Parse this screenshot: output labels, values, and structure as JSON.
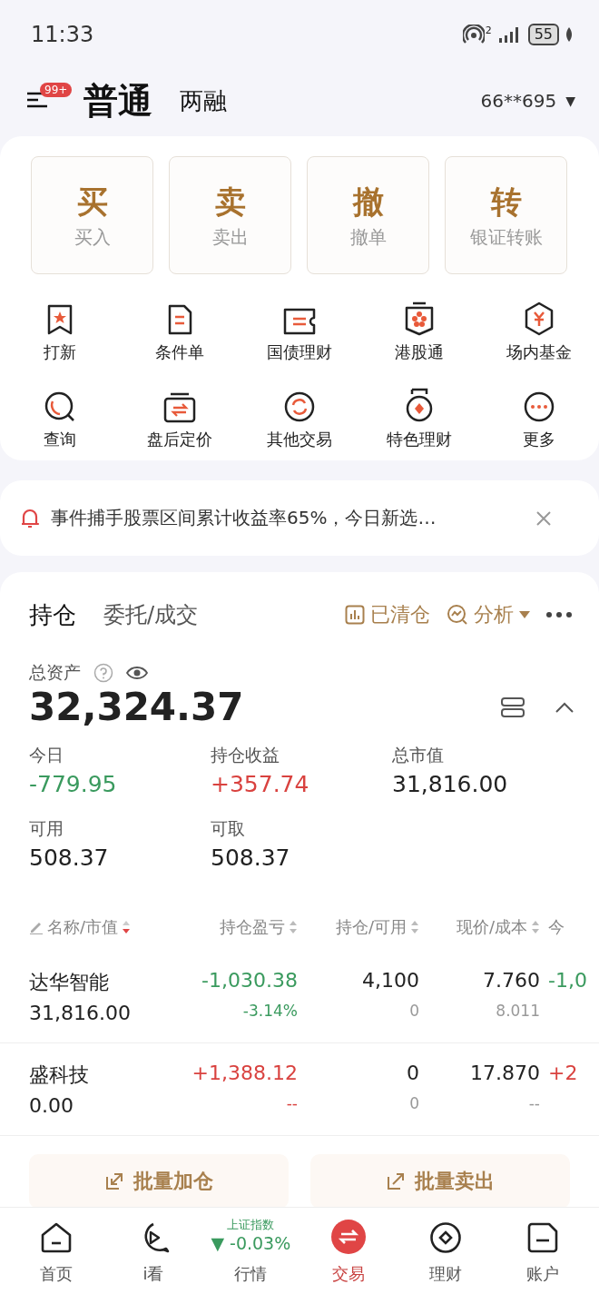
{
  "status_bar": {
    "time": "11:33",
    "hotspot_count": "2",
    "battery": "55"
  },
  "header": {
    "menu_badge": "99+",
    "tabs": [
      {
        "label": "普通",
        "selected": true
      },
      {
        "label": "两融",
        "selected": false
      }
    ],
    "account": "66**695",
    "account_caret": "▼"
  },
  "quick_actions": [
    {
      "glyph": "买",
      "label": "买入"
    },
    {
      "glyph": "卖",
      "label": "卖出"
    },
    {
      "glyph": "撤",
      "label": "撤单"
    },
    {
      "glyph": "转",
      "label": "银证转账"
    }
  ],
  "shortcuts": [
    {
      "label": "打新"
    },
    {
      "label": "条件单"
    },
    {
      "label": "国债理财"
    },
    {
      "label": "港股通"
    },
    {
      "label": "场内基金"
    },
    {
      "label": "查询"
    },
    {
      "label": "盘后定价"
    },
    {
      "label": "其他交易"
    },
    {
      "label": "特色理财"
    },
    {
      "label": "更多"
    }
  ],
  "notice": {
    "text": "事件捕手股票区间累计收益率65%，今日新选…"
  },
  "positions": {
    "tabs": [
      {
        "label": "持仓",
        "selected": true
      },
      {
        "label": "委托/成交",
        "selected": false
      }
    ],
    "actions": [
      {
        "label": "已清仓",
        "dropdown": false
      },
      {
        "label": "分析",
        "dropdown": true
      }
    ],
    "total_label": "总资产",
    "total": "32,324.37",
    "expanded": true,
    "stats": [
      {
        "label": "今日",
        "value": "-779.95",
        "color": "#3a9a5e"
      },
      {
        "label": "持仓收益",
        "value": "+357.74",
        "color": "#d9423f"
      },
      {
        "label": "总市值",
        "value": "31,816.00",
        "color": "#222222"
      },
      {
        "label": "可用",
        "value": "508.37",
        "color": "#222222"
      },
      {
        "label": "可取",
        "value": "508.37",
        "color": "#222222"
      }
    ],
    "table": {
      "columns": [
        {
          "label": "名称/市值",
          "sorted": true
        },
        {
          "label": "持仓盈亏",
          "sorted": false
        },
        {
          "label": "持仓/可用",
          "sorted": false
        },
        {
          "label": "现价/成本",
          "sorted": false
        },
        {
          "label": "今"
        }
      ],
      "rows": [
        {
          "name": "达华智能",
          "value": "31,816.00",
          "pnl": "-1,030.38",
          "pnl_pct": "-3.14%",
          "color": "#3a9a5e",
          "hold": "4,100",
          "avail": "0",
          "price": "7.760",
          "cost": "8.011",
          "today": "-1,0"
        },
        {
          "name": "盛科技",
          "value": "0.00",
          "pnl": "+1,388.12",
          "pnl_pct": "--",
          "color": "#d9423f",
          "hold": "0",
          "avail": "0",
          "price": "17.870",
          "cost": "--",
          "today": "+2"
        }
      ]
    },
    "batch_buttons": [
      {
        "label": "批量加仓",
        "kind": "add"
      },
      {
        "label": "批量卖出",
        "kind": "sell"
      }
    ]
  },
  "nav": {
    "index": {
      "name": "上证指数",
      "arrow": "▼",
      "change": "-0.03%",
      "color": "#3a9a5e"
    },
    "items": [
      {
        "label": "首页",
        "kind": "home",
        "selected": false
      },
      {
        "label": "i看",
        "kind": "watch",
        "selected": false
      },
      {
        "label": "行情",
        "kind": "market",
        "selected": false
      },
      {
        "label": "交易",
        "kind": "trade",
        "selected": true
      },
      {
        "label": "理财",
        "kind": "wealth",
        "selected": false
      },
      {
        "label": "账户",
        "kind": "account",
        "selected": false
      }
    ]
  }
}
